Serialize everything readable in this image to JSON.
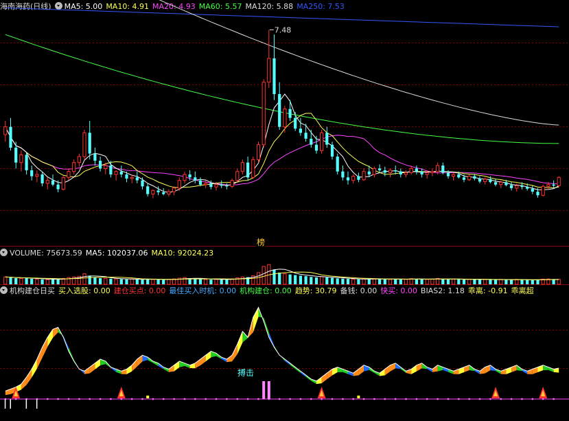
{
  "header": {
    "stock_title": "海南海药(日线)",
    "ma": [
      {
        "label": "MA5: 5.00",
        "color": "#ffffff"
      },
      {
        "label": "MA10: 4.91",
        "color": "#ffff55"
      },
      {
        "label": "MA20: 4.93",
        "color": "#ff44ff"
      },
      {
        "label": "MA60: 5.57",
        "color": "#44ff44"
      },
      {
        "label": "MA120: 5.88",
        "color": "#dddddd"
      },
      {
        "label": "MA250: 7.53",
        "color": "#3355ff"
      }
    ]
  },
  "price_panel": {
    "peak_label": "7.48",
    "rank_badge": "榜"
  },
  "volume_panel": {
    "label_volume": "VOLUME: 75673.59",
    "label_ma5": "MA5: 102037.06",
    "label_ma10": "MA10: 92024.23"
  },
  "indicator_panel": {
    "items": [
      {
        "label": "机构建仓日买",
        "color": "#dddddd"
      },
      {
        "label": "买入选股: 0.00",
        "color": "#ffff55"
      },
      {
        "label": "建仓买点: 0.00",
        "color": "#ff3333"
      },
      {
        "label": "最佳买入时机: 0.00",
        "color": "#44aaff"
      },
      {
        "label": "机构建仓: 0.00",
        "color": "#44ff44"
      },
      {
        "label": "趋势: 30.79",
        "color": "#ffff55"
      },
      {
        "label": "备钱: 0.00",
        "color": "#dddddd"
      },
      {
        "label": "快买: 0.00",
        "color": "#ff44ff"
      },
      {
        "label": "BIAS2: 1.18",
        "color": "#dddddd"
      },
      {
        "label": "乖离: -0.91",
        "color": "#ffff55"
      },
      {
        "label": "乖离超",
        "color": "#ffff55"
      }
    ],
    "signal_label": "搏击"
  },
  "colors": {
    "up": "#ff3333",
    "down": "#55ffff",
    "grid": "#8b0000",
    "ma5": "#ffffff",
    "ma10": "#ffff55",
    "ma20": "#ff44ff",
    "ma60": "#44ff44",
    "ma120": "#dddddd",
    "ma250": "#3355ff"
  },
  "chart_data": [
    {
      "type": "candlestick",
      "ohlc": [
        [
          5.72,
          5.95,
          5.6,
          5.85
        ],
        [
          5.85,
          6.0,
          5.45,
          5.5
        ],
        [
          5.5,
          5.6,
          5.15,
          5.25
        ],
        [
          5.25,
          5.45,
          5.1,
          5.38
        ],
        [
          5.38,
          5.42,
          5.05,
          5.12
        ],
        [
          5.12,
          5.2,
          4.95,
          5.02
        ],
        [
          5.02,
          5.12,
          4.92,
          5.05
        ],
        [
          5.05,
          5.1,
          4.85,
          4.9
        ],
        [
          4.9,
          5.0,
          4.8,
          4.95
        ],
        [
          4.95,
          5.05,
          4.85,
          4.88
        ],
        [
          4.88,
          4.95,
          4.75,
          4.8
        ],
        [
          4.8,
          5.02,
          4.78,
          5.0
        ],
        [
          5.0,
          5.15,
          4.95,
          5.1
        ],
        [
          5.1,
          5.3,
          5.05,
          5.25
        ],
        [
          5.25,
          5.4,
          5.18,
          5.35
        ],
        [
          5.35,
          5.8,
          5.3,
          5.75
        ],
        [
          5.75,
          5.95,
          5.3,
          5.4
        ],
        [
          5.4,
          5.5,
          5.2,
          5.28
        ],
        [
          5.28,
          5.35,
          5.1,
          5.15
        ],
        [
          5.15,
          5.25,
          5.05,
          5.2
        ],
        [
          5.2,
          5.28,
          5.0,
          5.05
        ],
        [
          5.05,
          5.12,
          4.95,
          5.1
        ],
        [
          5.1,
          5.2,
          5.0,
          5.05
        ],
        [
          5.05,
          5.1,
          4.92,
          4.98
        ],
        [
          4.98,
          5.05,
          4.9,
          5.0
        ],
        [
          5.0,
          5.1,
          4.9,
          4.95
        ],
        [
          4.95,
          5.0,
          4.8,
          4.85
        ],
        [
          4.85,
          4.9,
          4.68,
          4.72
        ],
        [
          4.72,
          4.8,
          4.65,
          4.78
        ],
        [
          4.78,
          4.85,
          4.7,
          4.75
        ],
        [
          4.75,
          4.82,
          4.7,
          4.72
        ],
        [
          4.72,
          4.8,
          4.68,
          4.76
        ],
        [
          4.76,
          4.85,
          4.7,
          4.82
        ],
        [
          4.82,
          5.0,
          4.78,
          4.95
        ],
        [
          4.95,
          5.1,
          4.9,
          5.05
        ],
        [
          5.05,
          5.12,
          4.95,
          5.0
        ],
        [
          5.0,
          5.1,
          4.9,
          4.95
        ],
        [
          4.95,
          5.0,
          4.85,
          4.88
        ],
        [
          4.88,
          4.95,
          4.82,
          4.9
        ],
        [
          4.9,
          4.95,
          4.8,
          4.84
        ],
        [
          4.84,
          4.92,
          4.78,
          4.88
        ],
        [
          4.88,
          4.95,
          4.82,
          4.86
        ],
        [
          4.86,
          4.9,
          4.8,
          4.85
        ],
        [
          4.85,
          4.98,
          4.82,
          4.95
        ],
        [
          4.95,
          5.15,
          4.92,
          5.1
        ],
        [
          5.1,
          5.3,
          5.05,
          5.25
        ],
        [
          5.25,
          5.35,
          4.95,
          5.0
        ],
        [
          5.0,
          5.35,
          4.98,
          5.3
        ],
        [
          5.3,
          5.6,
          5.25,
          5.55
        ],
        [
          5.55,
          6.65,
          5.5,
          6.6
        ],
        [
          6.6,
          7.48,
          6.5,
          7.0
        ],
        [
          7.0,
          7.4,
          6.3,
          6.4
        ],
        [
          6.4,
          6.6,
          5.8,
          5.85
        ],
        [
          5.85,
          6.2,
          5.75,
          6.15
        ],
        [
          6.15,
          6.3,
          5.95,
          6.0
        ],
        [
          6.0,
          6.1,
          5.78,
          5.82
        ],
        [
          5.82,
          6.0,
          5.7,
          5.75
        ],
        [
          5.75,
          5.9,
          5.6,
          5.65
        ],
        [
          5.65,
          5.8,
          5.5,
          5.55
        ],
        [
          5.55,
          5.7,
          5.4,
          5.45
        ],
        [
          5.45,
          5.8,
          5.4,
          5.75
        ],
        [
          5.75,
          5.85,
          5.5,
          5.55
        ],
        [
          5.55,
          5.6,
          5.3,
          5.35
        ],
        [
          5.35,
          5.4,
          5.05,
          5.1
        ],
        [
          5.1,
          5.2,
          4.95,
          5.0
        ],
        [
          5.0,
          5.1,
          4.88,
          4.95
        ],
        [
          4.95,
          5.05,
          4.9,
          5.02
        ],
        [
          5.02,
          5.08,
          4.92,
          4.96
        ],
        [
          4.96,
          5.15,
          4.94,
          5.1
        ],
        [
          5.1,
          5.2,
          5.0,
          5.05
        ],
        [
          5.05,
          5.18,
          5.0,
          5.15
        ],
        [
          5.15,
          5.22,
          5.08,
          5.12
        ],
        [
          5.12,
          5.18,
          5.02,
          5.08
        ],
        [
          5.08,
          5.15,
          5.0,
          5.12
        ],
        [
          5.12,
          5.2,
          5.05,
          5.1
        ],
        [
          5.1,
          5.15,
          5.0,
          5.05
        ],
        [
          5.05,
          5.12,
          5.0,
          5.08
        ],
        [
          5.08,
          5.2,
          5.05,
          5.15
        ],
        [
          5.15,
          5.2,
          5.05,
          5.1
        ],
        [
          5.1,
          5.15,
          5.0,
          5.05
        ],
        [
          5.05,
          5.12,
          4.98,
          5.08
        ],
        [
          5.08,
          5.15,
          5.02,
          5.1
        ],
        [
          5.1,
          5.25,
          5.05,
          5.2
        ],
        [
          5.2,
          5.25,
          5.05,
          5.08
        ],
        [
          5.08,
          5.12,
          4.98,
          5.02
        ],
        [
          5.02,
          5.08,
          4.95,
          5.05
        ],
        [
          5.05,
          5.1,
          4.98,
          5.0
        ],
        [
          5.0,
          5.05,
          4.92,
          4.96
        ],
        [
          4.96,
          5.05,
          4.94,
          5.02
        ],
        [
          5.02,
          5.06,
          4.95,
          4.98
        ],
        [
          4.98,
          5.02,
          4.9,
          4.93
        ],
        [
          4.93,
          5.0,
          4.88,
          4.97
        ],
        [
          4.97,
          5.02,
          4.9,
          4.92
        ],
        [
          4.92,
          4.98,
          4.85,
          4.88
        ],
        [
          4.88,
          4.95,
          4.82,
          4.92
        ],
        [
          4.92,
          4.96,
          4.85,
          4.87
        ],
        [
          4.87,
          4.92,
          4.78,
          4.82
        ],
        [
          4.82,
          4.9,
          4.76,
          4.86
        ],
        [
          4.86,
          4.92,
          4.8,
          4.84
        ],
        [
          4.84,
          4.9,
          4.78,
          4.81
        ],
        [
          4.81,
          4.86,
          4.72,
          4.76
        ],
        [
          4.76,
          4.82,
          4.66,
          4.7
        ],
        [
          4.7,
          4.88,
          4.68,
          4.85
        ],
        [
          4.85,
          4.92,
          4.8,
          4.88
        ],
        [
          4.88,
          4.95,
          4.82,
          4.86
        ],
        [
          4.86,
          5.02,
          4.84,
          5.0
        ]
      ],
      "y_range": [
        4.0,
        7.75
      ],
      "ma250_start": 7.85,
      "ma250_end": 7.53,
      "ma120_start": 9.2,
      "ma120_end": 5.88,
      "ma60_start": 7.4,
      "ma60_end": 5.57,
      "annotation": {
        "text": "7.48",
        "value": 7.48
      }
    },
    {
      "type": "bar",
      "volume": [
        60,
        55,
        50,
        48,
        52,
        45,
        42,
        40,
        38,
        44,
        40,
        48,
        55,
        60,
        65,
        85,
        70,
        55,
        50,
        48,
        45,
        44,
        42,
        40,
        42,
        40,
        38,
        45,
        40,
        38,
        36,
        40,
        44,
        50,
        55,
        48,
        46,
        42,
        40,
        38,
        40,
        42,
        38,
        44,
        52,
        60,
        58,
        70,
        95,
        145,
        160,
        120,
        95,
        85,
        80,
        75,
        70,
        66,
        60,
        56,
        62,
        56,
        52,
        48,
        46,
        44,
        42,
        40,
        44,
        42,
        46,
        44,
        42,
        40,
        44,
        42,
        40,
        46,
        44,
        42,
        40,
        42,
        48,
        44,
        40,
        42,
        40,
        38,
        42,
        40,
        38,
        40,
        38,
        36,
        40,
        38,
        36,
        40,
        38,
        36,
        34,
        36,
        42,
        44,
        42,
        40
      ],
      "y_max": 200
    },
    {
      "type": "area",
      "trend": [
        8,
        10,
        12,
        15,
        22,
        30,
        40,
        52,
        62,
        70,
        72,
        62,
        48,
        38,
        30,
        28,
        32,
        36,
        40,
        38,
        32,
        30,
        28,
        30,
        34,
        40,
        44,
        42,
        38,
        36,
        32,
        30,
        34,
        38,
        36,
        34,
        36,
        40,
        44,
        48,
        46,
        42,
        40,
        44,
        55,
        68,
        62,
        82,
        92,
        78,
        62,
        52,
        44,
        40,
        36,
        32,
        28,
        24,
        20,
        18,
        22,
        26,
        30,
        32,
        30,
        28,
        26,
        30,
        34,
        32,
        28,
        26,
        30,
        34,
        36,
        32,
        28,
        30,
        34,
        36,
        32,
        30,
        34,
        32,
        30,
        28,
        30,
        32,
        34,
        30,
        28,
        32,
        34,
        30,
        28,
        30,
        32,
        34,
        30,
        28,
        30,
        32,
        34,
        32,
        30,
        31
      ],
      "y_range": [
        -20,
        100
      ]
    }
  ]
}
